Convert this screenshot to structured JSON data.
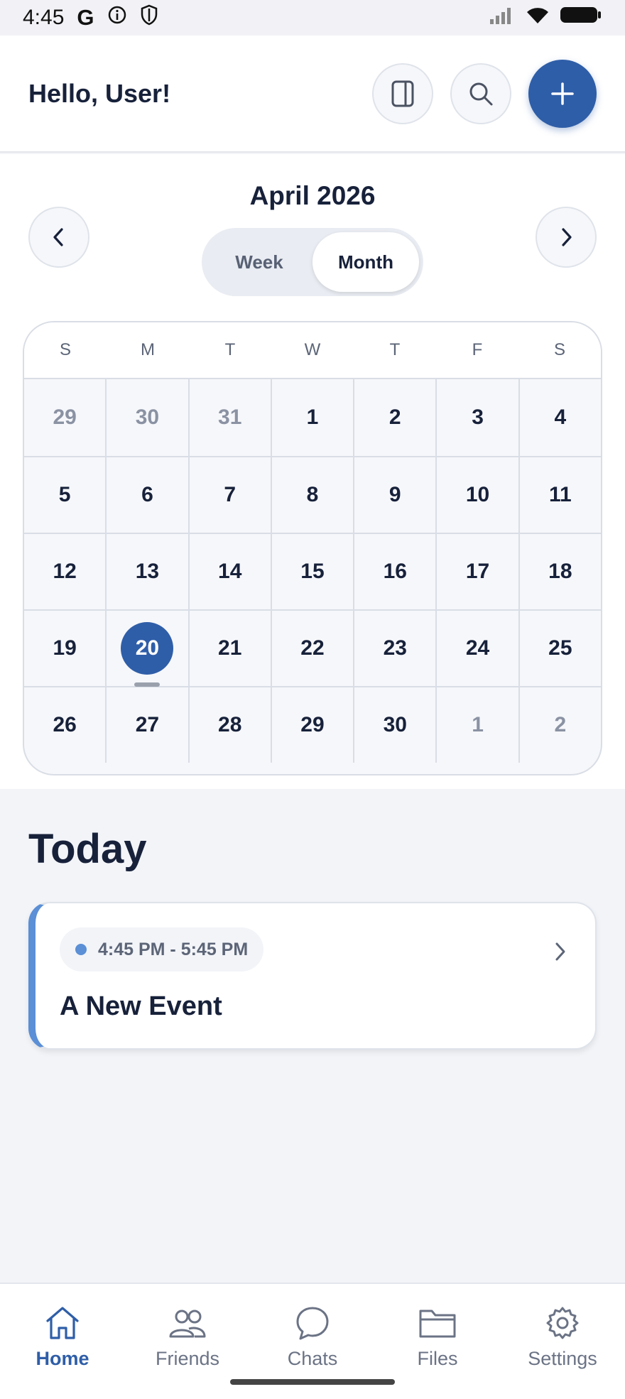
{
  "status_bar": {
    "time": "4:45",
    "left_icons": [
      "google-icon",
      "info-icon",
      "shield-icon"
    ],
    "right_icons": [
      "signal-icon",
      "wifi-icon",
      "battery-icon"
    ]
  },
  "header": {
    "greeting": "Hello, User!",
    "actions": [
      "sidebar-toggle-icon",
      "search-icon",
      "add-icon"
    ]
  },
  "calendar": {
    "month_title": "April 2026",
    "view_toggle": {
      "week_label": "Week",
      "month_label": "Month",
      "selected": "Month"
    },
    "weekdays": [
      "S",
      "M",
      "T",
      "W",
      "T",
      "F",
      "S"
    ],
    "weeks": [
      [
        {
          "d": "29",
          "muted": true
        },
        {
          "d": "30",
          "muted": true
        },
        {
          "d": "31",
          "muted": true
        },
        {
          "d": "1"
        },
        {
          "d": "2"
        },
        {
          "d": "3"
        },
        {
          "d": "4"
        }
      ],
      [
        {
          "d": "5"
        },
        {
          "d": "6"
        },
        {
          "d": "7"
        },
        {
          "d": "8"
        },
        {
          "d": "9"
        },
        {
          "d": "10"
        },
        {
          "d": "11"
        }
      ],
      [
        {
          "d": "12"
        },
        {
          "d": "13"
        },
        {
          "d": "14"
        },
        {
          "d": "15"
        },
        {
          "d": "16"
        },
        {
          "d": "17"
        },
        {
          "d": "18"
        }
      ],
      [
        {
          "d": "19"
        },
        {
          "d": "20",
          "today": true
        },
        {
          "d": "21"
        },
        {
          "d": "22"
        },
        {
          "d": "23"
        },
        {
          "d": "24"
        },
        {
          "d": "25"
        }
      ],
      [
        {
          "d": "26"
        },
        {
          "d": "27"
        },
        {
          "d": "28"
        },
        {
          "d": "29"
        },
        {
          "d": "30"
        },
        {
          "d": "1",
          "muted": true
        },
        {
          "d": "2",
          "muted": true
        }
      ]
    ]
  },
  "today": {
    "title": "Today",
    "events": [
      {
        "time": "4:45 PM - 5:45 PM",
        "title": "A New Event"
      }
    ]
  },
  "bottom_nav": {
    "items": [
      {
        "label": "Home",
        "icon": "home-icon",
        "active": true
      },
      {
        "label": "Friends",
        "icon": "friends-icon",
        "active": false
      },
      {
        "label": "Chats",
        "icon": "chat-icon",
        "active": false
      },
      {
        "label": "Files",
        "icon": "folder-icon",
        "active": false
      },
      {
        "label": "Settings",
        "icon": "gear-icon",
        "active": false
      }
    ]
  },
  "colors": {
    "accent": "#2f5ea8",
    "event_bar": "#5b8fd6",
    "background": "#f2f4f8"
  }
}
